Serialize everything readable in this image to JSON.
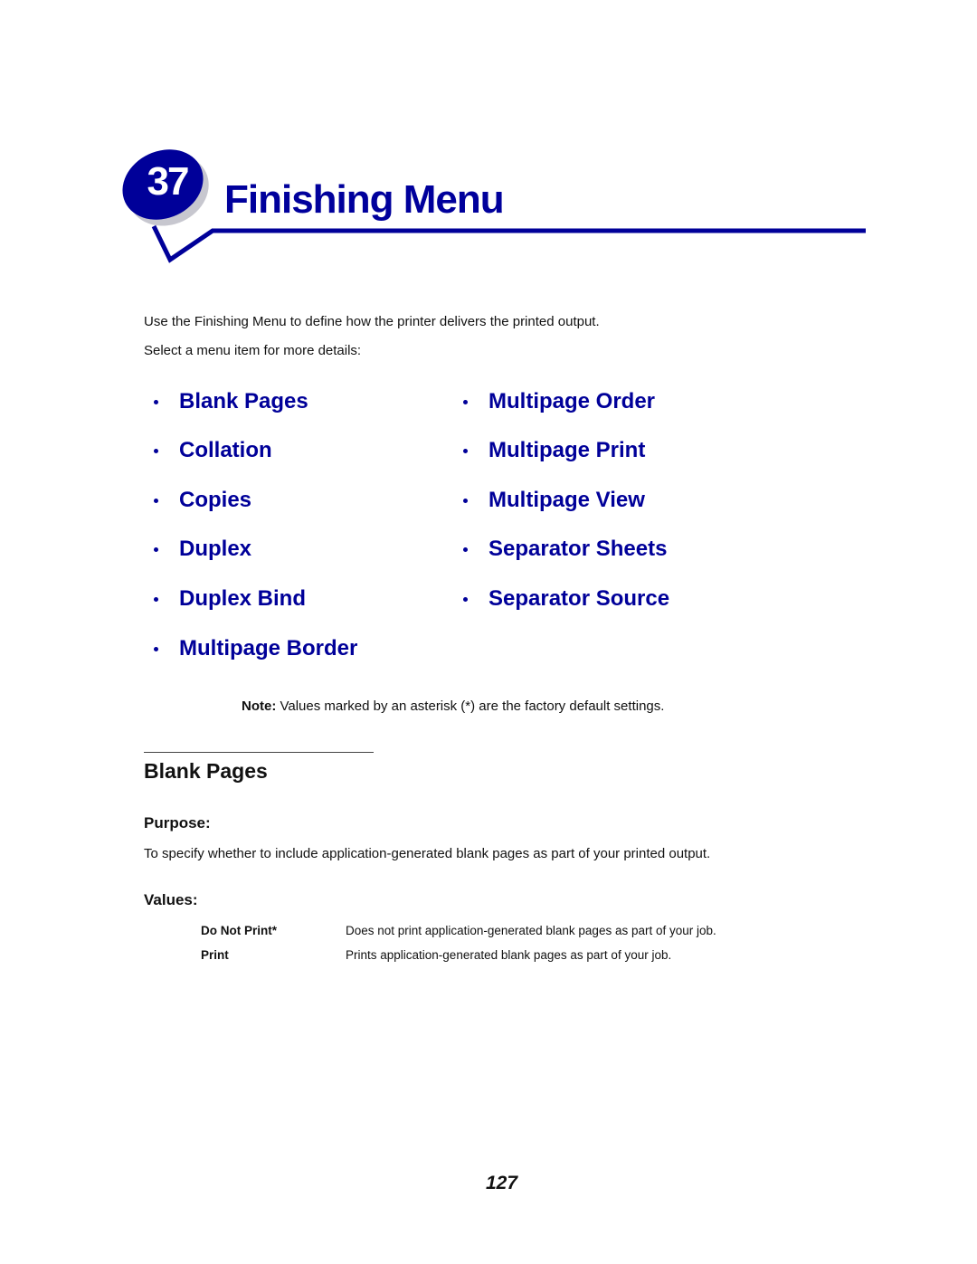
{
  "header": {
    "chapter_number": "37",
    "chapter_title": "Finishing Menu",
    "accent_color": "#000099"
  },
  "intro": {
    "line1": "Use the Finishing Menu to define how the printer delivers the printed output.",
    "line2": "Select a menu item for more details:"
  },
  "menu": {
    "left": [
      {
        "label": "Blank Pages"
      },
      {
        "label": "Collation"
      },
      {
        "label": "Copies"
      },
      {
        "label": "Duplex"
      },
      {
        "label": "Duplex Bind"
      },
      {
        "label": "Multipage Border"
      }
    ],
    "right": [
      {
        "label": "Multipage Order"
      },
      {
        "label": "Multipage Print"
      },
      {
        "label": "Multipage View"
      },
      {
        "label": "Separator Sheets"
      },
      {
        "label": "Separator Source"
      }
    ]
  },
  "note": {
    "label": "Note:",
    "text": " Values marked by an asterisk (*) are the factory default settings."
  },
  "section": {
    "title": "Blank Pages",
    "purpose_heading": "Purpose:",
    "purpose_text": "To specify whether to include application-generated blank pages as part of your printed output.",
    "values_heading": "Values:",
    "values": [
      {
        "name": "Do Not Print*",
        "description": "Does not print application-generated blank pages as part of your job."
      },
      {
        "name": "Print",
        "description": "Prints application-generated blank pages as part of your job."
      }
    ]
  },
  "footer": {
    "page_number": "127"
  }
}
